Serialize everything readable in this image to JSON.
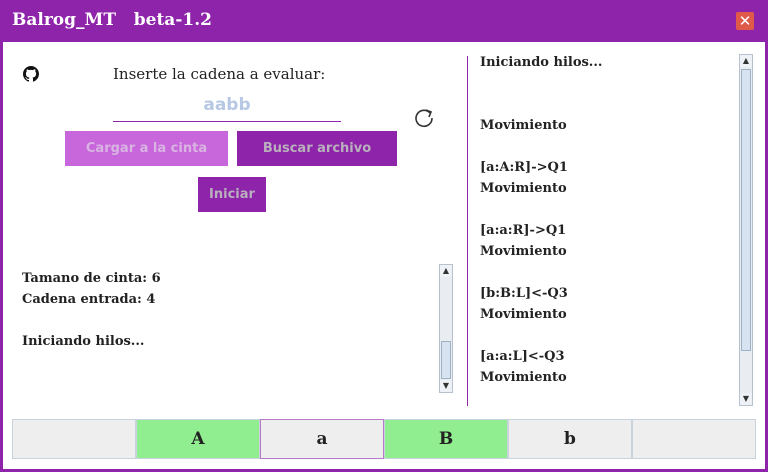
{
  "window": {
    "title": "Balrog_MT   beta-1.2",
    "close_glyph": "✕"
  },
  "left": {
    "prompt": "Inserte la cadena a evaluar:",
    "input_value": "aabb",
    "buttons": {
      "load": "Cargar a la cinta",
      "browse": "Buscar archivo",
      "start": "Iniciar"
    },
    "log": [
      "Tamano de cinta: 6",
      "Cadena entrada: 4",
      "",
      "Iniciando hilos..."
    ]
  },
  "right": {
    "log": [
      "Iniciando hilos...",
      "",
      "",
      "Movimiento",
      "",
      "[a:A:R]->Q1",
      "Movimiento",
      "",
      "[a:a:R]->Q1",
      "Movimiento",
      "",
      "[b:B:L]<-Q3",
      "Movimiento",
      "",
      "[a:a:L]<-Q3",
      "Movimiento"
    ]
  },
  "tape": {
    "cells": [
      "",
      "A",
      "a",
      "B",
      "b",
      ""
    ],
    "highlighted": [
      1,
      3
    ],
    "head_index": 2
  },
  "colors": {
    "accent": "#8e24aa",
    "light_accent": "#c866dc",
    "cell_green": "#90ee90",
    "close": "#e05a4a"
  },
  "icons": {
    "github": "github-icon",
    "refresh": "refresh-icon"
  }
}
